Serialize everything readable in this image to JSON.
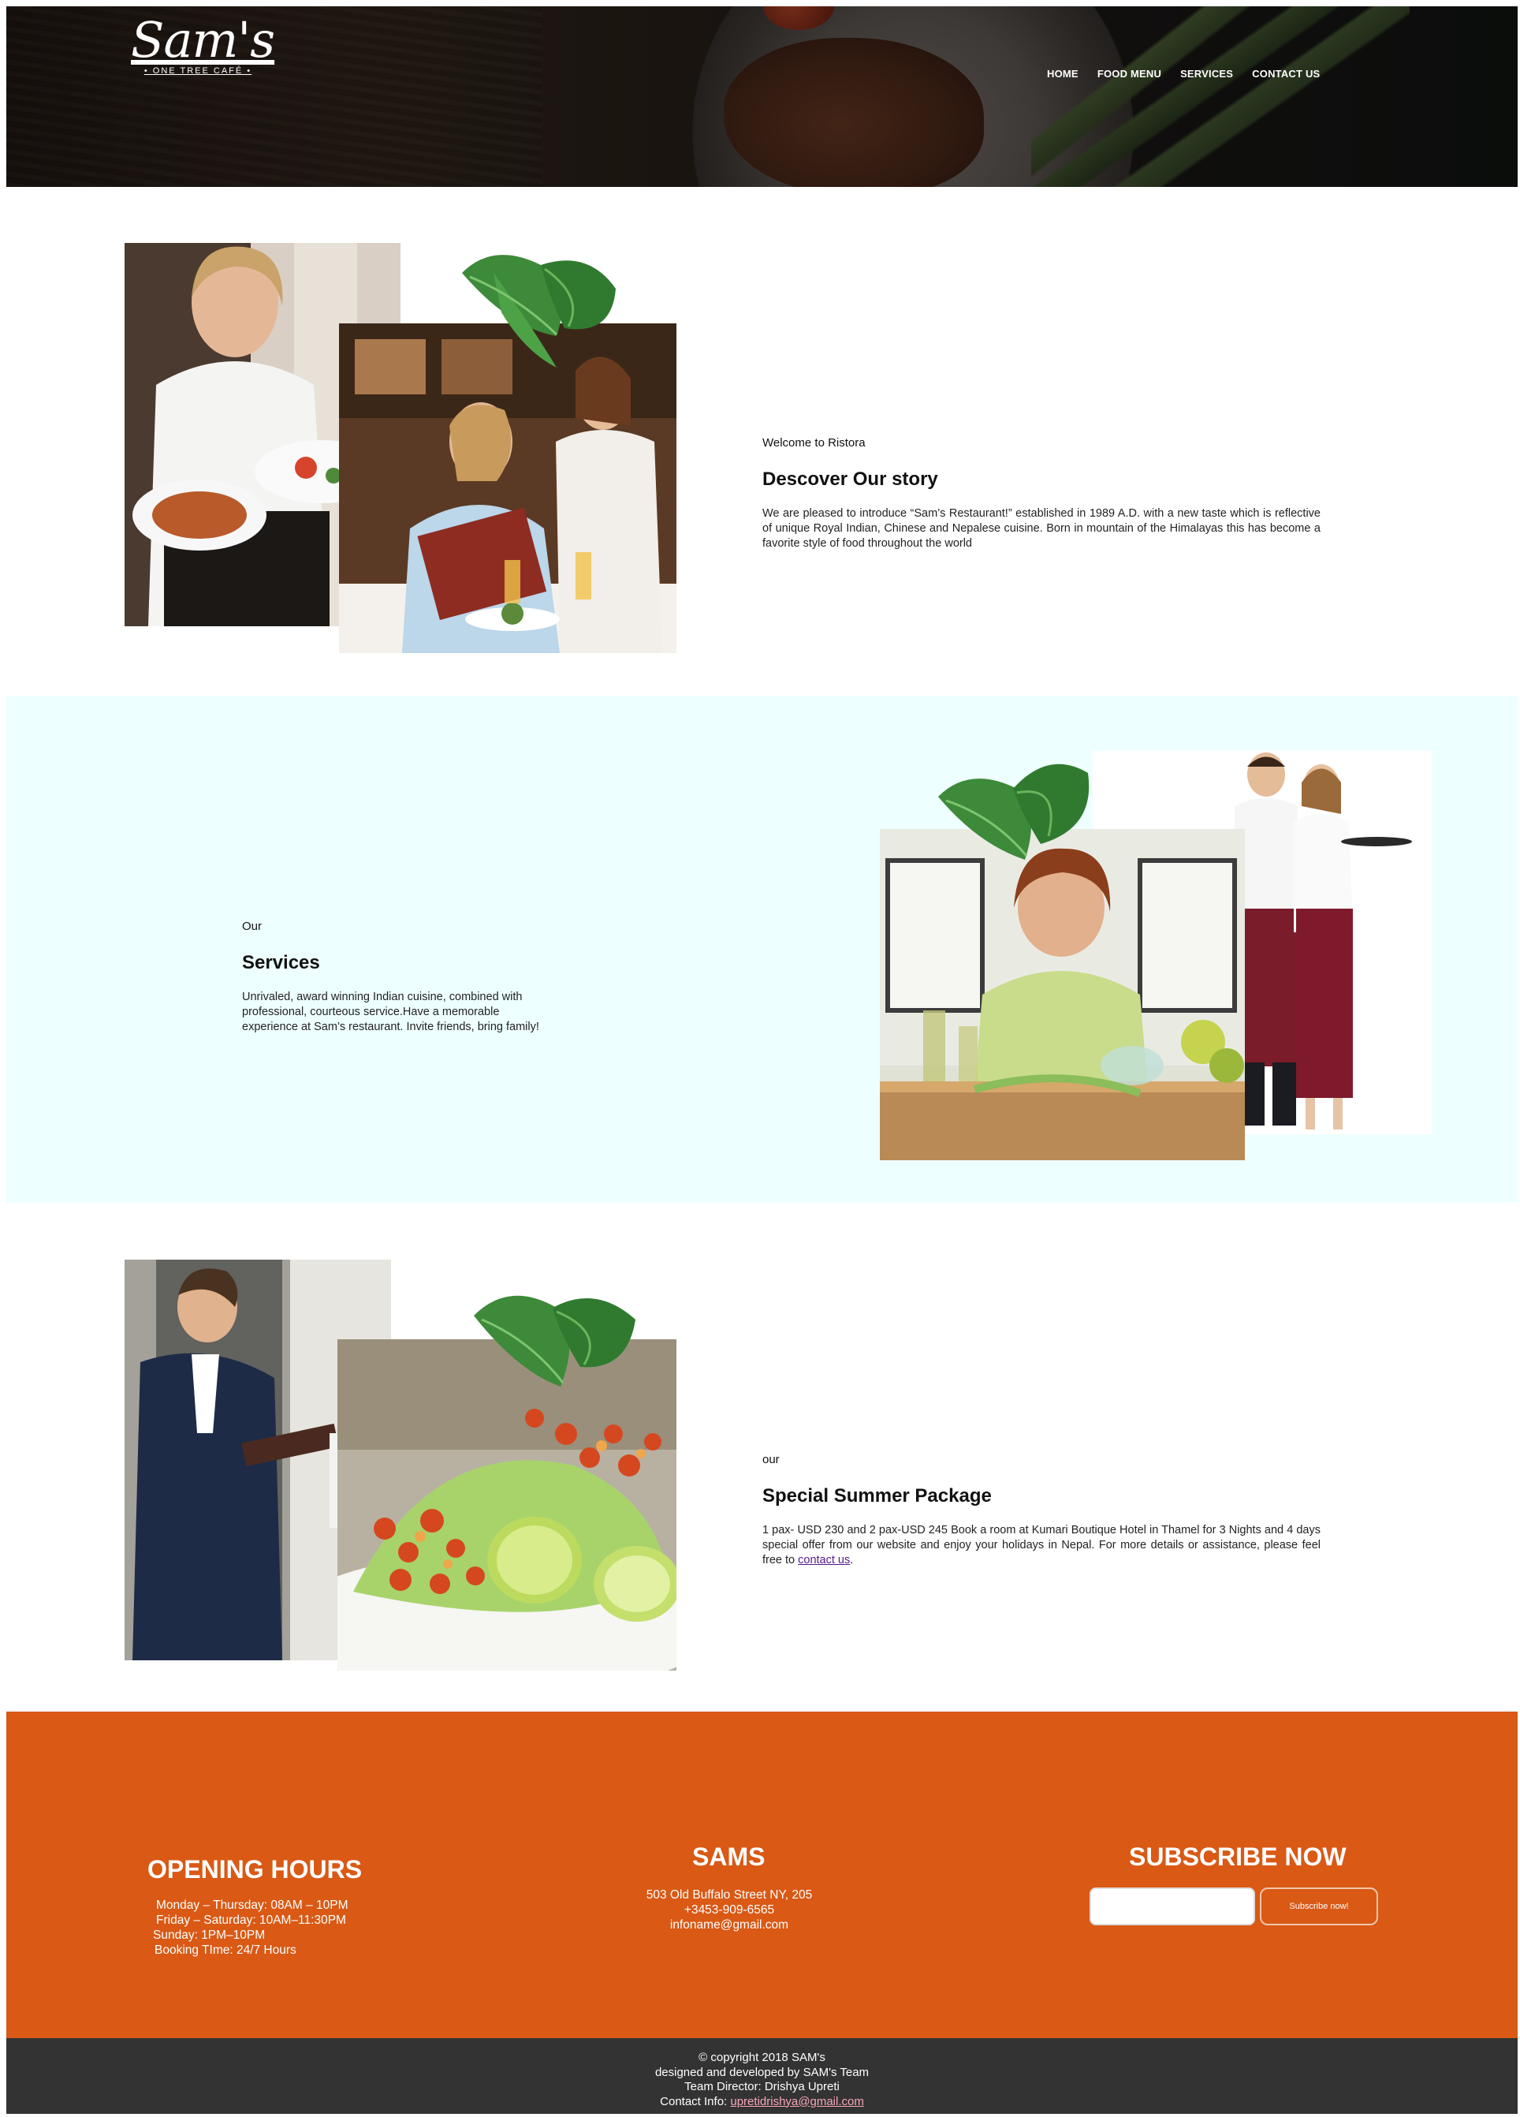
{
  "header": {
    "logo_text": "Sam's",
    "logo_subtitle": "• ONE TREE CAFÉ •",
    "nav": [
      "HOME",
      "FOOD MENU",
      "SERVICES",
      "CONTACT US"
    ]
  },
  "story": {
    "eyebrow": "Welcome to Ristora",
    "title": "Descover Our story",
    "body": "We are pleased to introduce “Sam’s Restaurant!” established in 1989 A.D. with a new taste which is reflective of unique Royal Indian, Chinese and Nepalese cuisine. Born in mountain of the Himalayas this has become a favorite style of food throughout the world"
  },
  "services": {
    "eyebrow": "Our",
    "title": "Services",
    "body": "Unrivaled, award winning Indian cuisine, combined with professional, courteous service.Have a memorable experience at Sam’s restaurant. Invite friends, bring family!"
  },
  "summer": {
    "eyebrow": "our",
    "title": "Special Summer Package",
    "body_prefix": "1 pax- USD 230 and 2 pax-USD 245 Book a room at Kumari Boutique Hotel in Thamel for 3 Nights and 4 days special offer from our website and enjoy your holidays in Nepal. For more details or assistance, please feel free to ",
    "link": "contact us",
    "body_suffix": "."
  },
  "footer": {
    "hours_title": "OPENING HOURS",
    "hours": [
      "Monday – Thursday: 08AM – 10PM",
      "Friday – Saturday: 10AM–11:30PM",
      "Sunday: 1PM–10PM",
      "Booking TIme: 24/7 Hours"
    ],
    "sams_title": "SAMS",
    "address": "503 Old Buffalo Street NY, 205",
    "phone": "+3453-909-6565",
    "email": "infoname@gmail.com",
    "subscribe_title": "SUBSCRIBE NOW",
    "subscribe_placeholder": "",
    "subscribe_button": "Subscribe now!"
  },
  "copyright": {
    "line1": "© copyright 2018 SAM's",
    "line2": "designed and developed by SAM's Team",
    "line3": "Team Director: Drishya Upreti",
    "contact_label": "Contact Info: ",
    "contact_email": "upretidrishya@gmail.com"
  },
  "colors": {
    "footer_orange": "#d95915",
    "services_band": "#eeffff",
    "copyright_bar": "#333333"
  }
}
